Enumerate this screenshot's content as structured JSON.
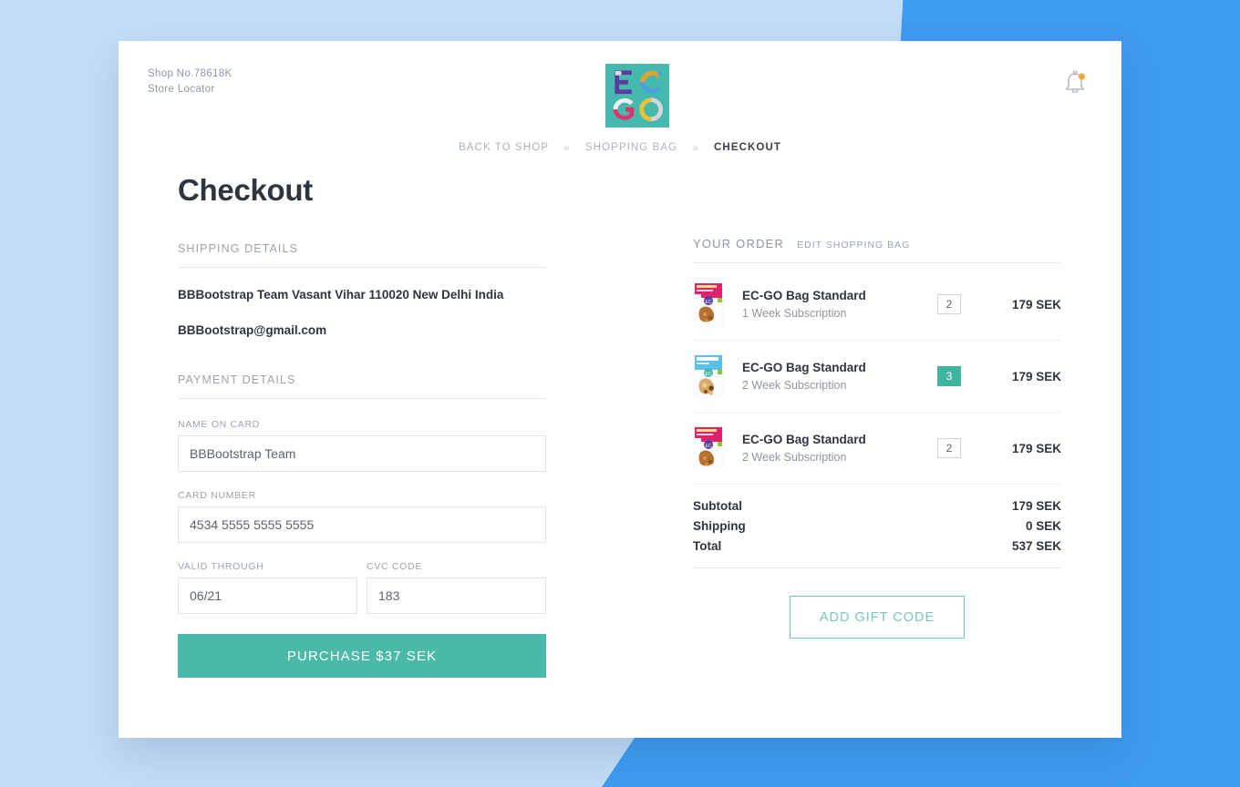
{
  "header": {
    "shop_no": "Shop No.78618K",
    "store_locator": "Store Locator",
    "logo_letters": [
      "E",
      "C",
      "G",
      "O"
    ],
    "logo_bg": "#45b9ae",
    "bell_icon": "notification-bell-icon",
    "bell_badge_color": "#f5a623"
  },
  "breadcrumb": {
    "items": [
      {
        "label": "BACK TO SHOP",
        "active": false
      },
      {
        "label": "SHOPPING BAG",
        "active": false
      },
      {
        "label": "CHECKOUT",
        "active": true
      }
    ],
    "separator": "»"
  },
  "page": {
    "title": "Checkout"
  },
  "shipping": {
    "section_label": "SHIPPING DETAILS",
    "address": "BBBootstrap Team Vasant Vihar 110020 New Delhi India",
    "email": "BBBootstrap@gmail.com"
  },
  "payment": {
    "section_label": "PAYMENT DETAILS",
    "name_label": "NAME ON CARD",
    "name_value": "BBBootstrap Team",
    "card_label": "CARD NUMBER",
    "card_value": "4534 5555 5555 5555",
    "valid_label": "VALID THROUGH",
    "valid_value": "06/21",
    "cvc_label": "CVC CODE",
    "cvc_value": "183",
    "purchase_label": "PURCHASE $37 SEK",
    "purchase_color": "#4bb9a7"
  },
  "order": {
    "title": "YOUR ORDER",
    "edit_label": "EDIT SHOPPING BAG",
    "items": [
      {
        "name": "EC-GO Bag Standard",
        "subscription": "1 Week Subscription",
        "qty": "2",
        "qty_highlight": false,
        "price": "179 SEK",
        "thumb": "product-bag-pink"
      },
      {
        "name": "EC-GO Bag Standard",
        "subscription": "2 Week Subscription",
        "qty": "3",
        "qty_highlight": true,
        "price": "179 SEK",
        "thumb": "product-bag-blue"
      },
      {
        "name": "EC-GO Bag Standard",
        "subscription": "2 Week Subscription",
        "qty": "2",
        "qty_highlight": false,
        "price": "179 SEK",
        "thumb": "product-bag-pink"
      }
    ],
    "totals": [
      {
        "label": "Subtotal",
        "value": "179 SEK"
      },
      {
        "label": "Shipping",
        "value": "0 SEK"
      },
      {
        "label": "Total",
        "value": "537 SEK"
      }
    ],
    "gift_label": "ADD GIFT CODE",
    "gift_color": "#6cc4b7",
    "qty_highlight_color": "#3fb5a0"
  }
}
